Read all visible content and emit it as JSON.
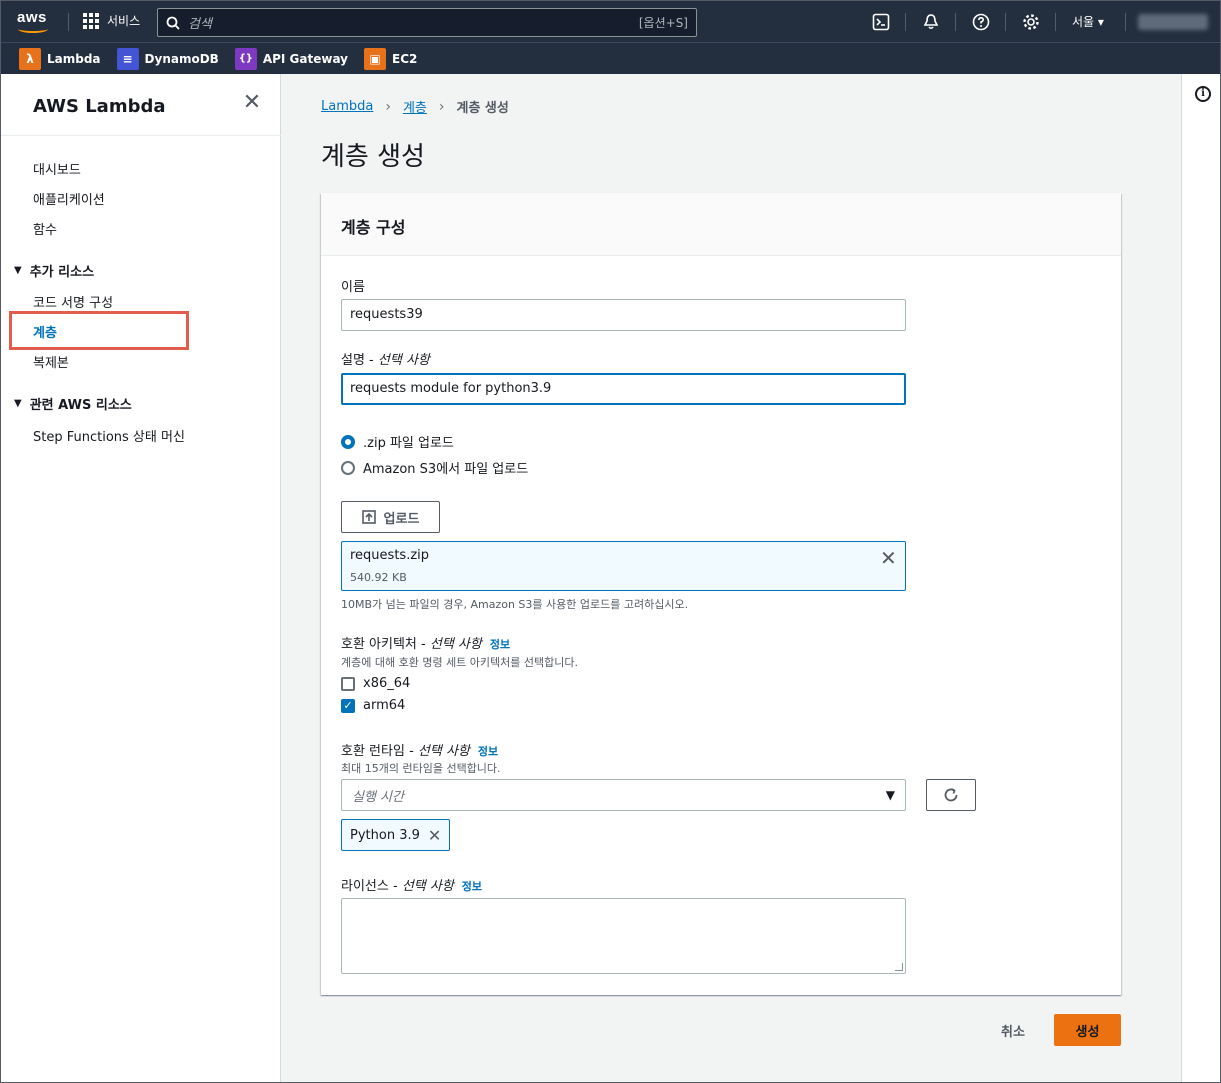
{
  "topnav": {
    "logo_text": "aws",
    "services_label": "서비스",
    "search_placeholder": "검색",
    "search_shortcut": "[옵션+S]",
    "region": "서울 ▾",
    "icons": [
      "cloudshell-icon",
      "bell-icon",
      "help-icon",
      "settings-icon"
    ]
  },
  "favorites": [
    {
      "label": "Lambda",
      "color": "#e8711c",
      "glyph": "λ"
    },
    {
      "label": "DynamoDB",
      "color": "#4354d4",
      "glyph": "≡"
    },
    {
      "label": "API Gateway",
      "color": "#7d3ac1",
      "glyph": "{}"
    },
    {
      "label": "EC2",
      "color": "#e8711c",
      "glyph": "▣"
    }
  ],
  "sidebar": {
    "title": "AWS Lambda",
    "items": [
      "대시보드",
      "애플리케이션",
      "함수"
    ],
    "section_more": "추가 리소스",
    "more_items": [
      "코드 서명 구성",
      "계층",
      "복제본"
    ],
    "section_related": "관련 AWS 리소스",
    "related_items": [
      "Step Functions 상태 머신"
    ]
  },
  "breadcrumb": {
    "items": [
      "Lambda",
      "계층"
    ],
    "current": "계층 생성"
  },
  "page_title": "계층 생성",
  "panel": {
    "title": "계층 구성",
    "name_label": "이름",
    "name_value": "requests39",
    "desc_label": "설명",
    "desc_optional": "선택 사항",
    "desc_value": "requests module for python3.9",
    "radio_zip": ".zip 파일 업로드",
    "radio_s3": "Amazon S3에서 파일 업로드",
    "upload_button": "업로드",
    "file_name": "requests.zip",
    "file_size": "540.92 KB",
    "file_hint": "10MB가 넘는 파일의 경우, Amazon S3를 사용한 업로드를 고려하십시오.",
    "arch_label": "호환 아키텍처",
    "arch_optional": "선택 사항",
    "info": "정보",
    "arch_hint": "계층에 대해 호환 명령 세트 아키텍처를 선택합니다.",
    "arch_x86": "x86_64",
    "arch_arm": "arm64",
    "runtime_label": "호환 런타임",
    "runtime_optional": "선택 사항",
    "runtime_hint": "최대 15개의 런타임을 선택합니다.",
    "runtime_placeholder": "실행 시간",
    "runtime_token": "Python 3.9",
    "license_label": "라이선스",
    "license_optional": "선택 사항"
  },
  "actions": {
    "cancel": "취소",
    "create": "생성"
  }
}
